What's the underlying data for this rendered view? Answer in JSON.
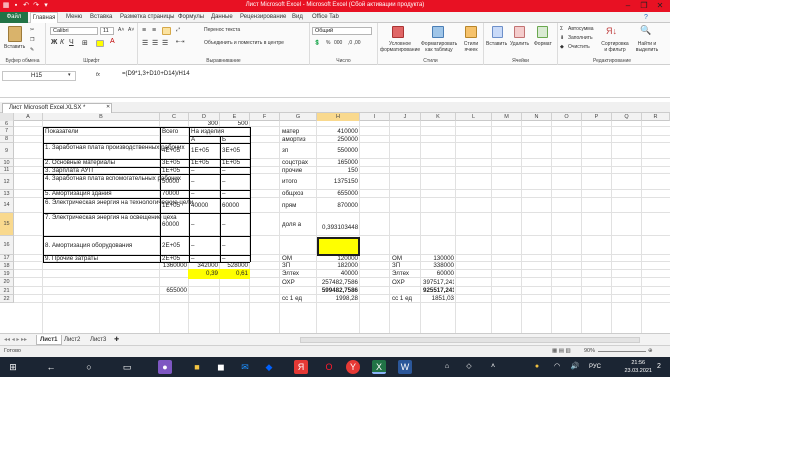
{
  "window": {
    "title": "Лист Microsoft Excel - Microsoft Excel (Сбой активации продукта)",
    "minimize": "–",
    "restore": "❐",
    "close": "✕"
  },
  "ribbon_tabs": [
    "Файл",
    "Главная",
    "Меню",
    "Вставка",
    "Разметка страницы",
    "Формулы",
    "Данные",
    "Рецензирование",
    "Вид",
    "Office Tab"
  ],
  "ribbon": {
    "clipboard": {
      "paste": "Вставить",
      "label": "Буфер обмена"
    },
    "font": {
      "name": "Calibri",
      "size": "11",
      "label": "Шрифт"
    },
    "alignment": {
      "wrap": "Перенос текста",
      "merge": "Объединить и поместить в центре",
      "label": "Выравнивание"
    },
    "number": {
      "format": "Общий",
      "percent": "%",
      "thousands": "000",
      "label": "Число"
    },
    "styles": {
      "conditional": "Условное форматирование",
      "table": "Форматировать как таблицу",
      "cell": "Стили ячеек",
      "label": "Стили"
    },
    "cells": {
      "insert": "Вставить",
      "delete": "Удалить",
      "format": "Формат",
      "label": "Ячейки"
    },
    "editing": {
      "autosum": "Автосумма",
      "fill": "Заполнить",
      "clear": "Очистить",
      "sort": "Сортировка и фильтр",
      "find": "Найти и выделить",
      "label": "Редактирование"
    }
  },
  "formula_bar": {
    "cell_ref": "H15",
    "fx": "fx",
    "formula": "=(D9*1,3+D10+D14)/H14"
  },
  "workbook_tab": "Лист Microsoft Excel.XLSX *",
  "columns": [
    "A",
    "B",
    "C",
    "D",
    "E",
    "F",
    "G",
    "H",
    "I",
    "J",
    "K",
    "L",
    "M",
    "N",
    "O",
    "P",
    "Q",
    "R"
  ],
  "rows": [
    "6",
    "7",
    "8",
    "9",
    "10",
    "11",
    "12",
    "13",
    "14",
    "15",
    "16",
    "17",
    "18",
    "19",
    "20",
    "21",
    "22"
  ],
  "cells": {
    "D6": "300",
    "E6": "500",
    "B7": "Показатели",
    "C7": "Всего",
    "D7": "На изделия",
    "G7": "матер",
    "H7": "410000",
    "D8": "А",
    "E8": "Б",
    "G8": "амортиз",
    "H8": "250000",
    "B9": "1. Заработная плата производственных рабочих",
    "C9": "4E+05",
    "D9": "1E+05",
    "E9": "3E+05",
    "G9": "зп",
    "H9": "550000",
    "B10": "2. Основные материалы",
    "C10": "3E+05",
    "D10": "1E+05",
    "E10": "1E+05",
    "G10": "соцстрах",
    "H10": "165000",
    "B11": "3. Зарплата АУП",
    "C11": "1E+05",
    "D11": "–",
    "E11": "–",
    "G11": "прочие",
    "H11": "150",
    "B12": "4. Заработная плата вспомогательных рабочих",
    "C12": "50000",
    "D12": "–",
    "E12": "–",
    "G12": "итого",
    "H12": "1375150",
    "B13": "5. Амортизация здания",
    "C13": "70000",
    "D13": "–",
    "E13": "–",
    "G13": "общхоз",
    "H13": "655000",
    "B14": "6. Электрическая энергия на технологические цели",
    "C14": "1E+05",
    "D14": "40000",
    "E14": "60000",
    "G14": "прям",
    "H14": "870000",
    "B15": "7. Электрическая энергия на освещение цеха",
    "C15": "60000",
    "D15": "–",
    "E15": "–",
    "G15": "доля а",
    "H15": "0,393103448",
    "B16": "8. Амортизация оборудования",
    "C16": "2E+05",
    "D16": "–",
    "E16": "–",
    "B17": "9. Прочие затраты",
    "C17": "2E+05",
    "D17": "–",
    "E17": "–",
    "G17": "ОМ",
    "H17": "120000",
    "J17": "ОМ",
    "K17": "130000",
    "C18": "1360000",
    "D18": "342000",
    "E18": "528000",
    "G18": "ЗП",
    "H18": "182000",
    "J18": "ЗП",
    "K18": "338000",
    "D19": "0,39",
    "E19": "0,61",
    "G19": "Элтех",
    "H19": "40000",
    "J19": "Элтех",
    "K19": "60000",
    "G20": "ОХР",
    "H20": "257482,7586",
    "J20": "ОХР",
    "K20": "397517,241",
    "C21": "655000",
    "H21": "599482,7586",
    "K21": "925517,241",
    "G22": "сс 1 ед",
    "H22": "1998,28",
    "J22": "сс 1 ед",
    "K22": "1851,03"
  },
  "sheets": [
    "Лист1",
    "Лист2",
    "Лист3"
  ],
  "status": {
    "ready": "Готово",
    "zoom": "90%"
  },
  "taskbar": {
    "time": "21:56",
    "date": "23.03.2021",
    "lang": "РУС",
    "notifications": "2"
  },
  "colors": {
    "excel_green": "#217346",
    "title_red": "#e81123",
    "highlight_yellow": "#ffff00",
    "taskbar": "#1b2533"
  }
}
